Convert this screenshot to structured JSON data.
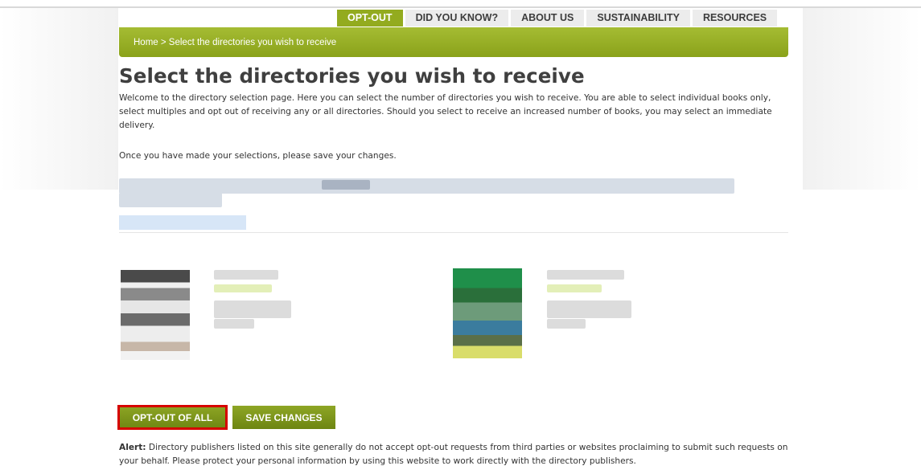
{
  "tabs": [
    {
      "label": "OPT-OUT",
      "active": true
    },
    {
      "label": "DID YOU KNOW?",
      "active": false
    },
    {
      "label": "ABOUT US",
      "active": false
    },
    {
      "label": "SUSTAINABILITY",
      "active": false
    },
    {
      "label": "RESOURCES",
      "active": false
    }
  ],
  "breadcrumb": {
    "home": "Home",
    "separator": " > ",
    "current": "Select the directories you wish to receive"
  },
  "page_title": "Select the directories you wish to receive",
  "intro_text": "Welcome to the directory selection page. Here you can select the number of directories you wish to receive. You are able to select individual books only, select multiples and opt out of receiving any or all directories. Should you select to receive an increased number of books, you may select an immediate delivery.",
  "save_note": "Once you have made your selections, please save your changes.",
  "buttons": {
    "opt_out_all": "OPT-OUT OF ALL",
    "save_changes": "SAVE CHANGES"
  },
  "alert": {
    "label": "Alert:",
    "text": " Directory publishers listed on this site generally do not accept opt-out requests from third parties or websites proclaiming to submit such requests on your behalf. Please protect your personal information by using this website to work directly with the directory publishers."
  },
  "colors": {
    "accent_green": "#93ab1f",
    "highlight_red": "#d60000"
  }
}
